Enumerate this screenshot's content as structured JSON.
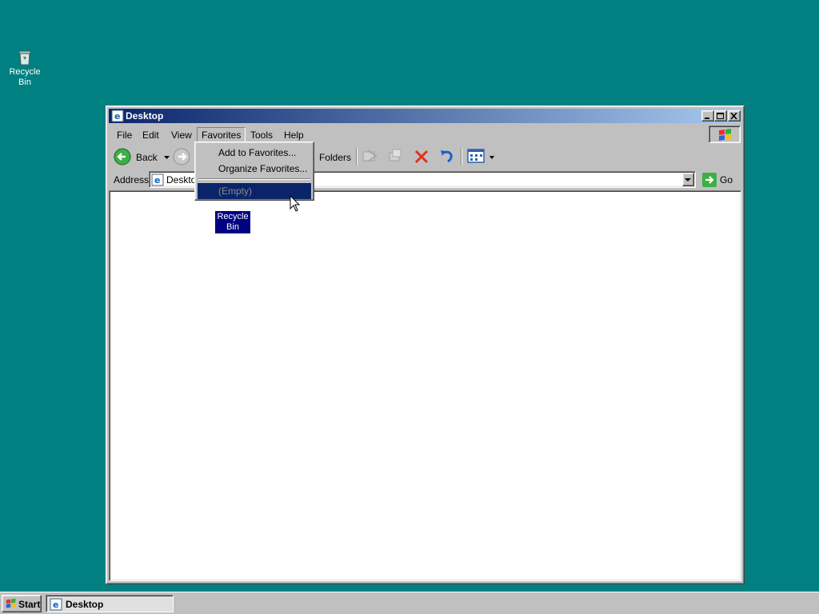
{
  "desktop": {
    "icons": [
      {
        "label_line1": "Recycle",
        "label_line2": "Bin",
        "icon": "recycle-bin-icon"
      }
    ]
  },
  "window": {
    "title": "Desktop",
    "menu": [
      "File",
      "Edit",
      "View",
      "Favorites",
      "Tools",
      "Help"
    ],
    "toolbar": {
      "back_label": "Back",
      "folders_label": "Folders"
    },
    "address": {
      "label": "Address",
      "value": "Desktop",
      "go_label": "Go"
    },
    "content_icon": {
      "label_line1": "Recycle",
      "label_line2": "Bin"
    }
  },
  "favorites_menu": {
    "items": [
      "Add to Favorites...",
      "Organize Favorites..."
    ],
    "empty_label": "(Empty)"
  },
  "taskbar": {
    "start_label": "Start",
    "task_label": "Desktop"
  },
  "colors": {
    "desktop": "#008080",
    "title_active": "#0a246a",
    "highlight": "#0a246a"
  }
}
